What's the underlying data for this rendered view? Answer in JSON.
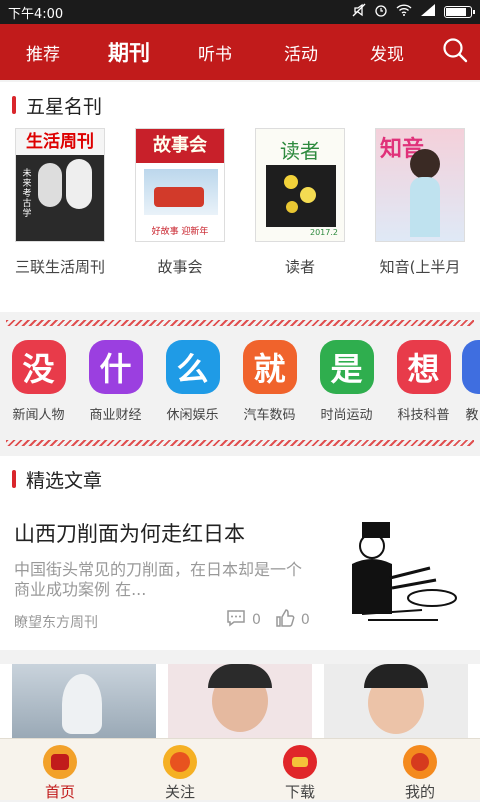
{
  "status": {
    "time": "下午4:00"
  },
  "nav": {
    "tabs": [
      {
        "label": "推荐"
      },
      {
        "label": "期刊"
      },
      {
        "label": "听书"
      },
      {
        "label": "活动"
      },
      {
        "label": "发现"
      }
    ],
    "active": "期刊"
  },
  "featured": {
    "title": "五星名刊",
    "magazines": [
      {
        "name": "三联生活周刊",
        "cover_text": "生活周刊",
        "cover_sub": "未来考古学"
      },
      {
        "name": "故事会",
        "cover_text": "故事会",
        "cover_sub": "好故事 迎新年"
      },
      {
        "name": "读者",
        "cover_text": "读者",
        "cover_sub": "2017.2"
      },
      {
        "name": "知音(上半月",
        "cover_text": "知音",
        "cover_sub": ""
      }
    ]
  },
  "categories": [
    {
      "char": "没",
      "label": "新闻人物",
      "color": "#e83b4a"
    },
    {
      "char": "什",
      "label": "商业财经",
      "color": "#9b3fe0"
    },
    {
      "char": "么",
      "label": "休闲娱乐",
      "color": "#1f9be6"
    },
    {
      "char": "就",
      "label": "汽车数码",
      "color": "#f0632c"
    },
    {
      "char": "是",
      "label": "时尚运动",
      "color": "#2fae4e"
    },
    {
      "char": "想",
      "label": "科技科普",
      "color": "#e83b4a"
    },
    {
      "char": "",
      "label": "教",
      "color": "#3f6ee0"
    }
  ],
  "selected": {
    "title": "精选文章",
    "article": {
      "title": "山西刀削面为何走红日本",
      "desc": "中国街头常见的刀削面，在日本却是一个商业成功案例                    在...",
      "source": "瞭望东方周刊",
      "comments": "0",
      "likes": "0"
    }
  },
  "bottom": {
    "tabs": [
      {
        "label": "首页"
      },
      {
        "label": "关注"
      },
      {
        "label": "下载"
      },
      {
        "label": "我的"
      }
    ]
  }
}
